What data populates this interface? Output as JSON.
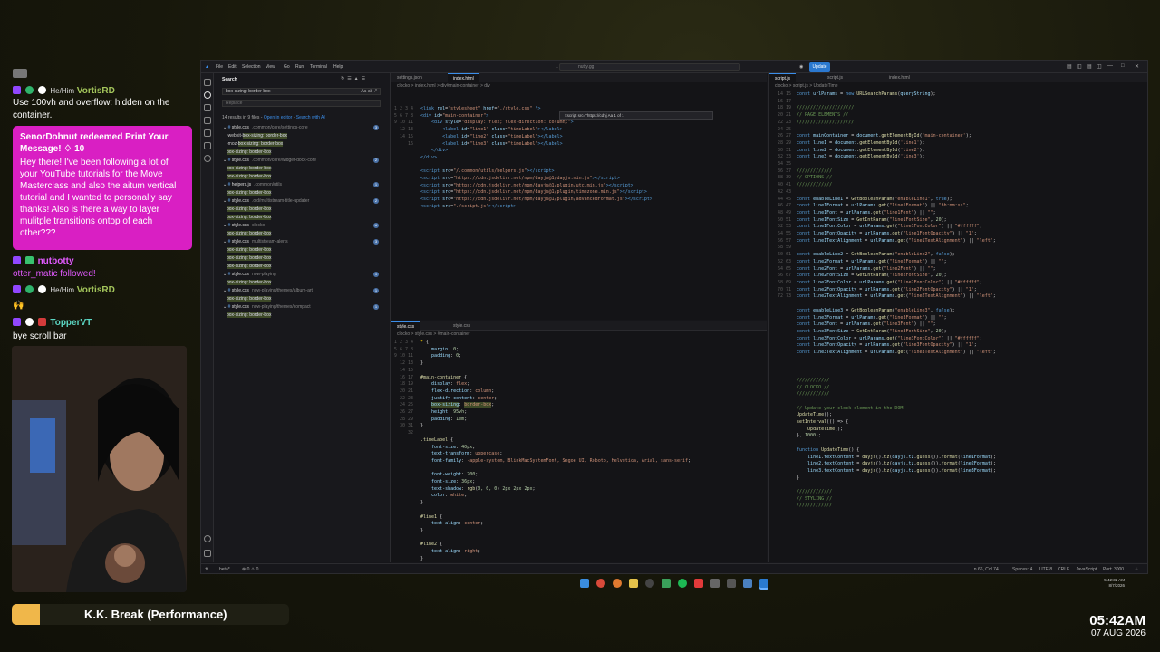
{
  "chat": {
    "msgs": [
      {
        "user": "VortisRD",
        "title": "He/Him",
        "text": "Use 100vh and overflow: hidden on the",
        "text2": "container."
      },
      {
        "user": "nutbotty",
        "text": "otter_matic followed!"
      },
      {
        "user": "VortisRD",
        "title": "He/Him",
        "text": "🙌"
      },
      {
        "user": "TopperVT",
        "text": "bye scroll bar"
      }
    ],
    "highlight": {
      "title": "SenorDohnut redeemed Print Your Message! ♢ 10",
      "body": "Hey there! I've been following a lot of your YouTube tutorials for the Move Masterclass and also the aitum vertical tutorial and I wanted to personally say thanks! Also is there a way to layer mulitple transitions ontop of each other???"
    }
  },
  "song": {
    "title": "K.K. Break (Performance)",
    "progress": 0.1
  },
  "clock": {
    "time": "05:42AM",
    "date": "07 AUG 2026"
  },
  "vscode": {
    "menu": [
      "File",
      "Edit",
      "Selection",
      "View",
      "Go",
      "Run",
      "Terminal",
      "Help"
    ],
    "command_center": "nutty.gg",
    "update_label": "Update",
    "search": {
      "header": "Search",
      "query": "box-sizing: border-box",
      "replace_placeholder": "Replace",
      "results_summary": "14 results in 9 files",
      "open_in_editor": "Open in editor",
      "search_ai": "Search with AI",
      "results": [
        {
          "type": "file",
          "name": "style.css",
          "path": ".common/core/settings-core",
          "count": "3"
        },
        {
          "type": "match",
          "pre": "-webkit-",
          "hl": "box-sizing: border-box"
        },
        {
          "type": "match",
          "pre": "-moz-",
          "hl": "box-sizing: border-box"
        },
        {
          "type": "match",
          "pre": "",
          "hl": "box-sizing: border-box"
        },
        {
          "type": "file",
          "name": "style.css",
          "path": ".common/core/widget-dock-core",
          "count": "2"
        },
        {
          "type": "match",
          "pre": "",
          "hl": "box-sizing: border-box"
        },
        {
          "type": "match",
          "pre": "",
          "hl": "box-sizing: border-box"
        },
        {
          "type": "file",
          "name": "helpers.js",
          "path": ".common/utils",
          "count": "1"
        },
        {
          "type": "match",
          "pre": "",
          "hl": "box-sizing: border-box"
        },
        {
          "type": "file",
          "name": "style.css",
          "path": ".old/multistream-title-updater",
          "count": "2"
        },
        {
          "type": "match",
          "pre": "",
          "hl": "box-sizing: border-box"
        },
        {
          "type": "match",
          "pre": "",
          "hl": "box-sizing: border-box"
        },
        {
          "type": "file",
          "name": "style.css",
          "path": "clocko",
          "count": "U"
        },
        {
          "type": "match",
          "pre": "",
          "hl": "box-sizing: border-box"
        },
        {
          "type": "file",
          "name": "style.css",
          "path": "multistream-alerts",
          "count": "3"
        },
        {
          "type": "match",
          "pre": "",
          "hl": "box-sizing: border-box"
        },
        {
          "type": "match",
          "pre": "",
          "hl": "box-sizing: border-box"
        },
        {
          "type": "match",
          "pre": "",
          "hl": "box-sizing: border-box"
        },
        {
          "type": "file",
          "name": "style.css",
          "path": "now-playing",
          "count": "1"
        },
        {
          "type": "match",
          "pre": "",
          "hl": "box-sizing: border-box"
        },
        {
          "type": "file",
          "name": "style.css",
          "path": "now-playing/themes/album-art",
          "count": "1"
        },
        {
          "type": "match",
          "pre": "",
          "hl": "box-sizing: border-box"
        },
        {
          "type": "file",
          "name": "style.css",
          "path": "now-playing/themes/compact",
          "count": "1"
        },
        {
          "type": "match",
          "pre": "",
          "hl": "box-sizing: border-box"
        }
      ]
    },
    "left_top": {
      "tabs": [
        "settings.json",
        "index.html"
      ],
      "breadcrumb": "clocko > index.html > div#main-container > div",
      "find_text": "<script src=\"https://cdnj Aa   1 of 1"
    },
    "left_bottom": {
      "tabs": [
        "style.css",
        "style.css"
      ],
      "breadcrumb": "clocko > style.css > #main-container"
    },
    "right": {
      "tabs": [
        "script.js",
        "script.js",
        "index.html"
      ],
      "breadcrumb": "clocko > script.js > UpdateTime"
    },
    "status": {
      "branch": "beta*",
      "problems": "⊗ 0 ⚠ 0",
      "position": "Ln 66, Col 74",
      "spaces": "Spaces: 4",
      "encoding": "UTF-8",
      "eol": "CRLF",
      "lang": "JavaScript",
      "port": "Port: 3000"
    }
  },
  "taskbar": {
    "time": "5:42:32 AM",
    "date": "8/7/2026"
  },
  "colors": {
    "accent": "#d91fc3",
    "song": "#f0b74a",
    "vscode_blue": "#2b78d0"
  }
}
